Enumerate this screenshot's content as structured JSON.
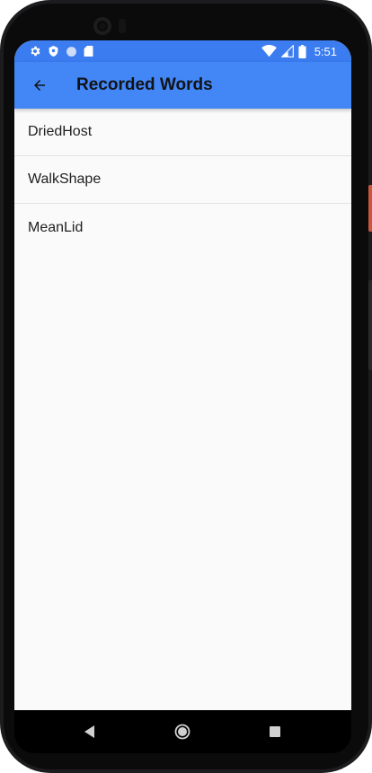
{
  "status_bar": {
    "time": "5:51",
    "left_icons": [
      "gear-icon",
      "shield-icon",
      "circle-icon",
      "sd-card-icon"
    ],
    "right_icons": [
      "wifi-icon",
      "signal-icon",
      "battery-icon"
    ]
  },
  "app_bar": {
    "title": "Recorded Words",
    "back_icon": "arrow-back-icon",
    "background": "#4287f5"
  },
  "words": [
    {
      "label": "DriedHost"
    },
    {
      "label": "WalkShape"
    },
    {
      "label": "MeanLid"
    }
  ],
  "nav_bar": {
    "buttons": [
      "back-triangle-icon",
      "home-circle-icon",
      "recents-square-icon"
    ]
  }
}
